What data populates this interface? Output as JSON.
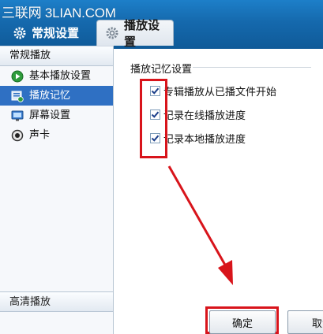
{
  "header": {
    "watermark": "三联网 3LIAN.COM",
    "tabs": [
      {
        "label": "常规设置",
        "icon": "gear-icon",
        "active": false
      },
      {
        "label": "播放设置",
        "icon": "gear-icon",
        "active": true
      }
    ]
  },
  "sidebar": {
    "section_title": "常规播放",
    "items": [
      {
        "label": "基本播放设置",
        "icon": "play-circle-icon",
        "selected": false
      },
      {
        "label": "播放记忆",
        "icon": "memory-icon",
        "selected": true
      },
      {
        "label": "屏幕设置",
        "icon": "monitor-icon",
        "selected": false
      },
      {
        "label": "声卡",
        "icon": "speaker-icon",
        "selected": false
      }
    ],
    "footer_title": "高清播放"
  },
  "content": {
    "group_title": "播放记忆设置",
    "options": [
      {
        "label": "专辑播放从已播文件开始",
        "checked": true
      },
      {
        "label": "记录在线播放进度",
        "checked": true
      },
      {
        "label": "记录本地播放进度",
        "checked": true
      }
    ]
  },
  "buttons": {
    "ok": "确定",
    "cancel": "取消"
  },
  "colors": {
    "header_blue": "#1569ad",
    "selection_blue": "#2f70c3",
    "highlight_red": "#d8141b"
  }
}
